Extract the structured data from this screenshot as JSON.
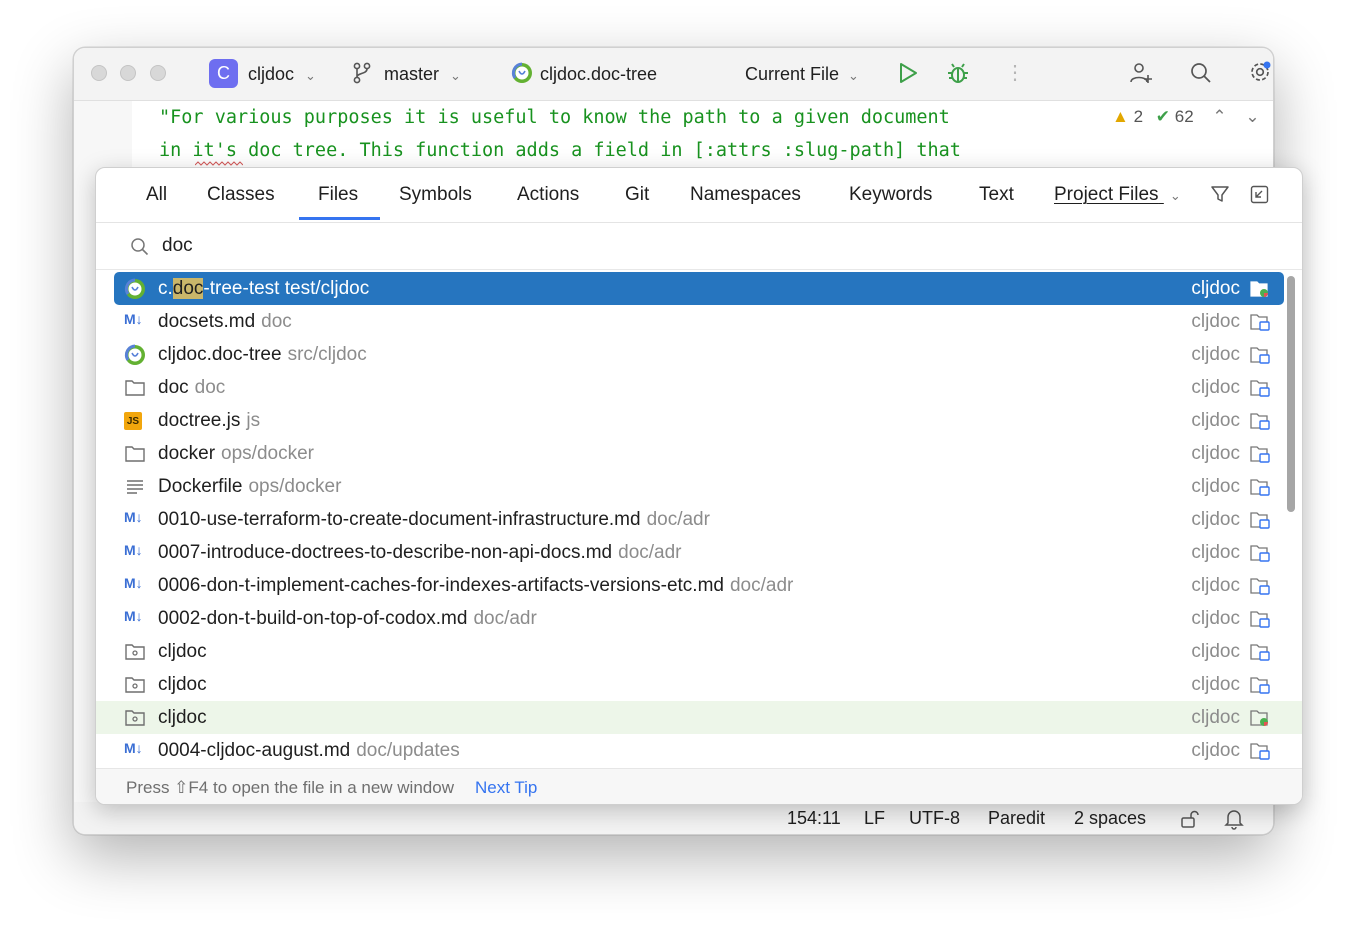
{
  "titlebar": {
    "project_badge": "C",
    "project": "cljdoc",
    "branch": "master",
    "file": "cljdoc.doc-tree",
    "run_config": "Current File"
  },
  "editor": {
    "line1": "\"For various purposes it is useful to know the path to a given document",
    "line2": "in it's doc tree. This function adds a field in [:attrs :slug-path] that",
    "warnings": "2",
    "checks": "62"
  },
  "popup": {
    "tabs": [
      "All",
      "Classes",
      "Files",
      "Symbols",
      "Actions",
      "Git",
      "Namespaces",
      "Keywords",
      "Text",
      "Project Files"
    ],
    "active_tab": "Files",
    "search": "doc",
    "results": [
      {
        "icon": "clojure-icon",
        "name_pre": "c.",
        "name_hl": "doc",
        "name_post": "-tree-test",
        "path": "test/cljdoc",
        "module": "cljdoc",
        "selected": true
      },
      {
        "icon": "markdown-icon",
        "name": "docsets.md",
        "path": "doc",
        "module": "cljdoc"
      },
      {
        "icon": "clojure-icon",
        "name": "cljdoc.doc-tree",
        "path": "src/cljdoc",
        "module": "cljdoc"
      },
      {
        "icon": "folder-icon",
        "name": "doc",
        "path": "doc",
        "module": "cljdoc"
      },
      {
        "icon": "js-icon",
        "name": "doctree.js",
        "path": "js",
        "module": "cljdoc"
      },
      {
        "icon": "folder-icon",
        "name": "docker",
        "path": "ops/docker",
        "module": "cljdoc"
      },
      {
        "icon": "text-file-icon",
        "name": "Dockerfile",
        "path": "ops/docker",
        "module": "cljdoc"
      },
      {
        "icon": "markdown-icon",
        "name": "0010-use-terraform-to-create-document-infrastructure.md",
        "path": "doc/adr",
        "module": "cljdoc"
      },
      {
        "icon": "markdown-icon",
        "name": "0007-introduce-doctrees-to-describe-non-api-docs.md",
        "path": "doc/adr",
        "module": "cljdoc"
      },
      {
        "icon": "markdown-icon",
        "name": "0006-don-t-implement-caches-for-indexes-artifacts-versions-etc.md",
        "path": "doc/adr",
        "module": "cljdoc"
      },
      {
        "icon": "markdown-icon",
        "name": "0002-don-t-build-on-top-of-codox.md",
        "path": "doc/adr",
        "module": "cljdoc"
      },
      {
        "icon": "package-folder-icon",
        "name": "cljdoc",
        "path": "",
        "module": "cljdoc"
      },
      {
        "icon": "package-folder-icon",
        "name": "cljdoc",
        "path": "",
        "module": "cljdoc"
      },
      {
        "icon": "package-folder-icon",
        "name": "cljdoc",
        "path": "",
        "module": "cljdoc",
        "tinted": true
      },
      {
        "icon": "markdown-icon",
        "name": "0004-cljdoc-august.md",
        "path": "doc/updates",
        "module": "cljdoc"
      }
    ],
    "footer_tip": "Press ⇧F4 to open the file in a new window",
    "footer_link": "Next Tip"
  },
  "statusbar": {
    "position": "154:11",
    "line_sep": "LF",
    "encoding": "UTF-8",
    "mode": "Paredit",
    "indent": "2 spaces"
  },
  "colors": {
    "selection": "#2675bf",
    "accent": "#3574f0",
    "code_string": "#18921f",
    "project_badge": "#6e6ef0"
  }
}
